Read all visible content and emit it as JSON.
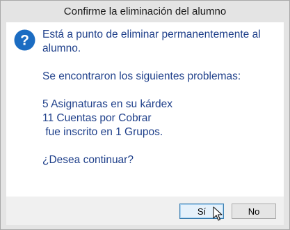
{
  "dialog": {
    "title": "Confirme la eliminación del alumno",
    "icon": "question-icon",
    "accent": "#1b6cc2",
    "text_color": "#1e3f8a",
    "message": {
      "line1": "Está a punto de eliminar permanentemente al\nalumno.",
      "line2": "Se encontraron los siguientes problemas:",
      "line3": "5 Asignaturas en su kárdex\n11 Cuentas por Cobrar\n fue inscrito en 1 Grupos.",
      "line4": "¿Desea continuar?"
    },
    "buttons": {
      "yes_label": "Sí",
      "no_label": "No"
    }
  }
}
